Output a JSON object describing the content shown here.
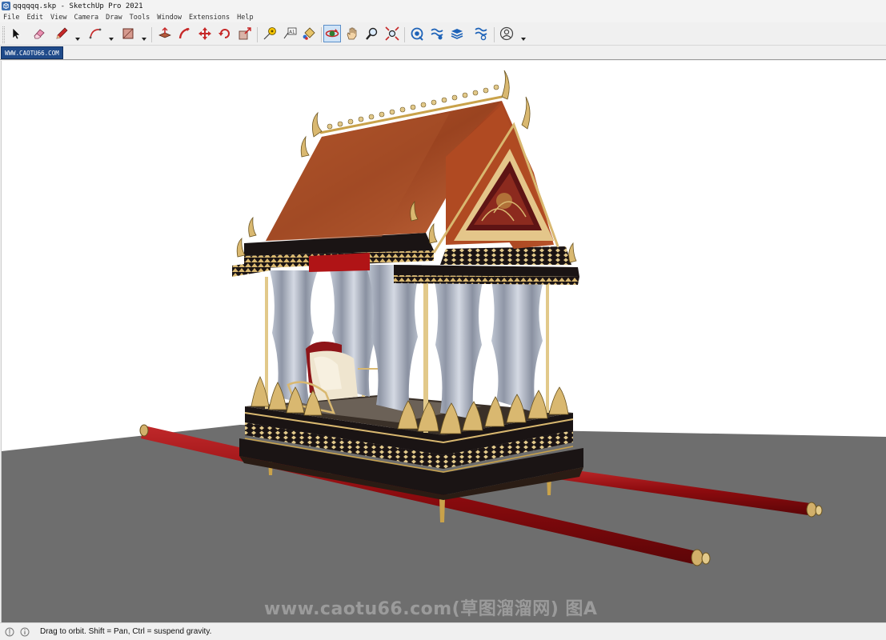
{
  "window": {
    "title": "qqqqqq.skp - SketchUp Pro 2021",
    "app_icon": "sketchup-logo-icon"
  },
  "menubar": {
    "items": [
      "File",
      "Edit",
      "View",
      "Camera",
      "Draw",
      "Tools",
      "Window",
      "Extensions",
      "Help"
    ]
  },
  "toolbar": {
    "tools": [
      {
        "id": "select",
        "icon": "arrow-cursor-icon"
      },
      {
        "id": "eraser",
        "icon": "eraser-icon"
      },
      {
        "id": "line",
        "icon": "pencil-icon"
      },
      {
        "id": "arc",
        "icon": "arc-icon"
      },
      {
        "id": "rectangle",
        "icon": "rectangle-icon"
      },
      {
        "id": "push-pull",
        "icon": "push-pull-icon"
      },
      {
        "id": "follow-me",
        "icon": "follow-me-icon"
      },
      {
        "id": "move",
        "icon": "move-icon"
      },
      {
        "id": "rotate",
        "icon": "rotate-icon"
      },
      {
        "id": "scale",
        "icon": "scale-icon"
      },
      {
        "id": "tape-measure",
        "icon": "tape-measure-icon"
      },
      {
        "id": "text",
        "icon": "text-icon"
      },
      {
        "id": "paint-bucket",
        "icon": "paint-bucket-icon"
      },
      {
        "id": "orbit",
        "icon": "orbit-icon",
        "active": true
      },
      {
        "id": "pan",
        "icon": "pan-hand-icon"
      },
      {
        "id": "zoom",
        "icon": "zoom-icon"
      },
      {
        "id": "zoom-extents",
        "icon": "zoom-extents-icon"
      },
      {
        "id": "3d-warehouse",
        "icon": "warehouse-icon"
      },
      {
        "id": "extension-warehouse",
        "icon": "extension-warehouse-icon"
      },
      {
        "id": "layout",
        "icon": "layout-stack-icon"
      },
      {
        "id": "extension-manager",
        "icon": "extension-manager-icon"
      },
      {
        "id": "account",
        "icon": "user-account-icon"
      }
    ]
  },
  "scene_tab": {
    "label": "WWW.CAOTU66.COM"
  },
  "viewport": {
    "background_color": "#ffffff",
    "ground_color": "#6e6e6e",
    "watermark": "www.caotu66.com(草图溜溜网) 图A"
  },
  "statusbar": {
    "message": "Drag to orbit. Shift = Pan, Ctrl = suspend gravity.",
    "icons": [
      "geo-location-icon",
      "info-icon"
    ]
  },
  "colors": {
    "accent": "#1f4a8a",
    "roof": "#a24a1f",
    "trim_gold": "#c9a24a",
    "pole_red": "#9b0f12",
    "base_dark": "#1a1414"
  }
}
